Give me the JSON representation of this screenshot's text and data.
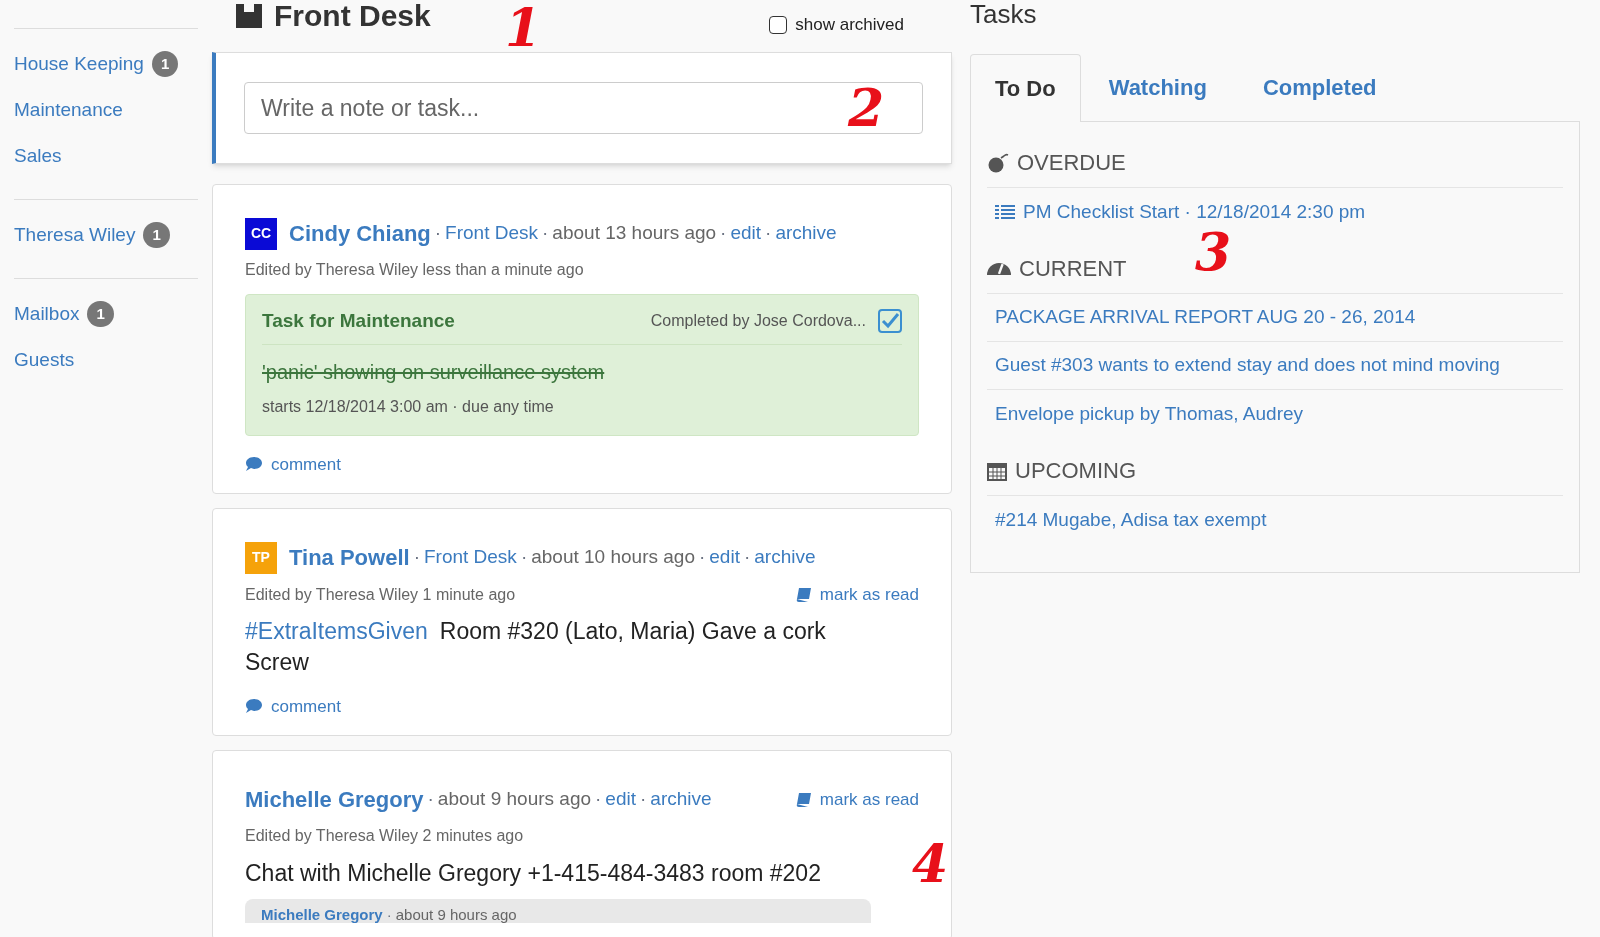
{
  "sidebar": {
    "groups": [
      {
        "items": [
          {
            "label": "House Keeping",
            "count": "1"
          },
          {
            "label": "Maintenance"
          },
          {
            "label": "Sales"
          }
        ]
      },
      {
        "items": [
          {
            "label": "Theresa Wiley",
            "count": "1"
          }
        ]
      },
      {
        "items": [
          {
            "label": "Mailbox",
            "count": "1"
          },
          {
            "label": "Guests"
          }
        ]
      }
    ]
  },
  "feed": {
    "title": "Front Desk",
    "show_archived": {
      "label": "show archived",
      "checked": false
    },
    "composer": {
      "placeholder": "Write a note or task..."
    },
    "posts": [
      {
        "avatar": {
          "initials": "CC",
          "color": "#0a0ad6"
        },
        "author": "Cindy Chiang",
        "group": "Front Desk",
        "time": "about 13 hours ago",
        "actions": [
          "edit",
          "archive"
        ],
        "edited": "Edited by Theresa Wiley less than a minute ago",
        "body": {
          "kind": "task",
          "title": "Task for Maintenance",
          "completed_by": "Completed by Jose Cordova...",
          "checked": true,
          "text": "'panic' showing on surveillance system",
          "meta": "starts 12/18/2014 3:00 am · due any time"
        },
        "comment": "comment"
      },
      {
        "avatar": {
          "initials": "TP",
          "color": "#f5a20a"
        },
        "author": "Tina Powell",
        "group": "Front Desk",
        "time": "about 10 hours ago",
        "actions": [
          "edit",
          "archive"
        ],
        "mark_read": "mark as read",
        "edited": "Edited by Theresa Wiley 1 minute ago",
        "body": {
          "kind": "text",
          "hashtag": "#ExtraItemsGiven",
          "text": "Room #320 (Lato, Maria) Gave a cork Screw"
        },
        "comment": "comment"
      },
      {
        "author": "Michelle Gregory",
        "time": "about 9 hours ago",
        "actions": [
          "edit",
          "archive"
        ],
        "mark_read": "mark as read",
        "edited": "Edited by Theresa Wiley 2 minutes ago",
        "body": {
          "kind": "chat",
          "text": "Chat with Michelle Gregory +1-415-484-3483 room #202",
          "quote": {
            "author": "Michelle Gregory",
            "time": "about 9 hours ago"
          }
        }
      }
    ]
  },
  "tasks": {
    "title": "Tasks",
    "tabs": [
      {
        "label": "To Do",
        "selected": true
      },
      {
        "label": "Watching",
        "selected": false
      },
      {
        "label": "Completed",
        "selected": false
      }
    ],
    "sections": [
      {
        "kind": "overdue",
        "title": "OVERDUE",
        "items": [
          {
            "text": "PM Checklist Start · 12/18/2014 2:30 pm",
            "list_icon": true
          }
        ]
      },
      {
        "kind": "current",
        "title": "CURRENT",
        "items": [
          {
            "text": "PACKAGE ARRIVAL REPORT AUG 20 - 26, 2014"
          },
          {
            "text": "Guest #303 wants to extend stay and does not mind moving"
          },
          {
            "text": "Envelope pickup by Thomas, Audrey"
          }
        ]
      },
      {
        "kind": "upcoming",
        "title": "UPCOMING",
        "items": [
          {
            "text": "#214 Mugabe, Adisa tax exempt"
          }
        ]
      }
    ]
  },
  "separator": "·",
  "annotations": [
    {
      "text": "1"
    },
    {
      "text": "2"
    },
    {
      "text": "3"
    },
    {
      "text": "4"
    }
  ]
}
